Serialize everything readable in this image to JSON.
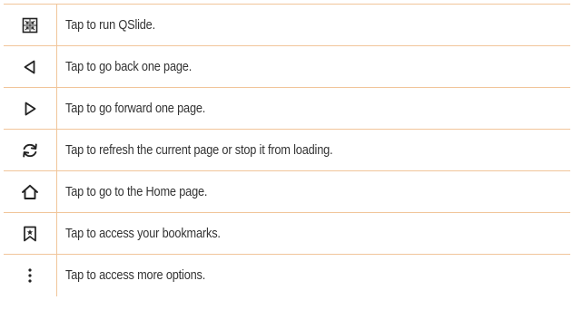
{
  "rows": [
    {
      "icon": "qslide-icon",
      "description": "Tap to run QSlide."
    },
    {
      "icon": "back-arrow-icon",
      "description": "Tap to go back one page."
    },
    {
      "icon": "forward-arrow-icon",
      "description": "Tap to go forward one page."
    },
    {
      "icon": "refresh-icon",
      "description": "Tap to refresh the current page or stop it from loading."
    },
    {
      "icon": "home-icon",
      "description": "Tap to go to the Home page."
    },
    {
      "icon": "bookmark-icon",
      "description": "Tap to access your bookmarks."
    },
    {
      "icon": "more-options-icon",
      "description": "Tap to access more options."
    }
  ],
  "colors": {
    "rule": "#f1c59a",
    "icon": "#222222",
    "text": "#333333"
  }
}
